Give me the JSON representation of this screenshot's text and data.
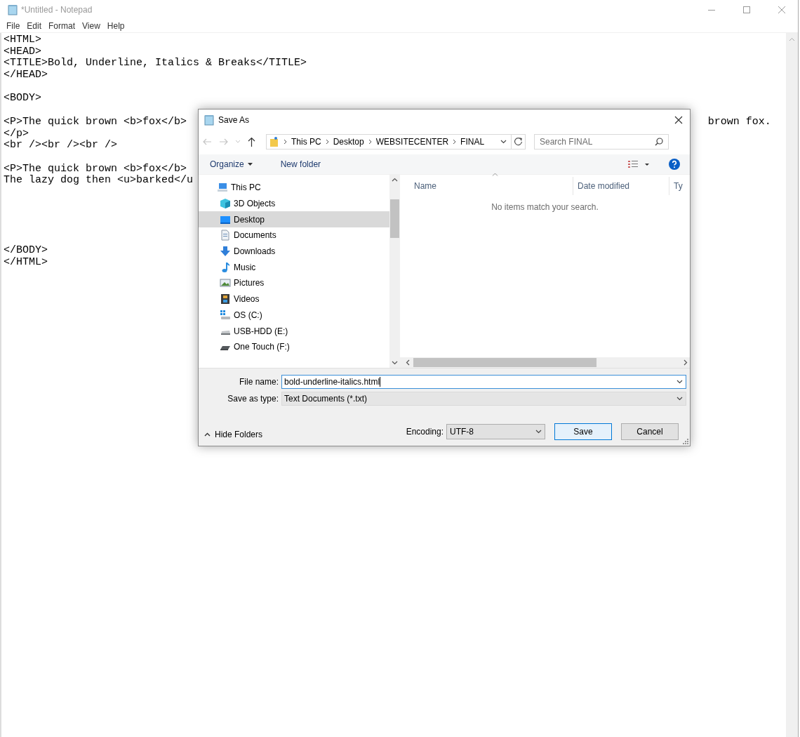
{
  "window": {
    "title": "*Untitled - Notepad"
  },
  "menu": [
    "File",
    "Edit",
    "Format",
    "View",
    "Help"
  ],
  "editor": {
    "lines": [
      {
        "kind": "text",
        "text": "<HTML>"
      },
      {
        "kind": "text",
        "text": "<HEAD>"
      },
      {
        "kind": "text",
        "text": "<TITLE>Bold, Underline, Italics & Breaks</TITLE>"
      },
      {
        "kind": "text",
        "text": "</HEAD>"
      },
      {
        "kind": "blank"
      },
      {
        "kind": "text",
        "text": "<BODY>"
      },
      {
        "kind": "blank"
      },
      {
        "kind": "split",
        "text": "<P>The quick brown <b>fox</b>",
        "text_right": "brown fox."
      },
      {
        "kind": "text",
        "text": "</p>"
      },
      {
        "kind": "text",
        "text": "<br /><br /><br />"
      },
      {
        "kind": "blank"
      },
      {
        "kind": "text",
        "text": "<P>The quick brown <b>fox</b>"
      },
      {
        "kind": "text",
        "text": "The lazy dog then <u>barked</u"
      },
      {
        "kind": "blank"
      },
      {
        "kind": "blank"
      },
      {
        "kind": "blank"
      },
      {
        "kind": "blank"
      },
      {
        "kind": "blank"
      },
      {
        "kind": "text",
        "text": "</BODY>"
      },
      {
        "kind": "text",
        "text": "</HTML>"
      }
    ]
  },
  "dialog": {
    "title": "Save As",
    "breadcrumb": [
      "This PC",
      "Desktop",
      "WEBSITECENTER",
      "FINAL"
    ],
    "search": {
      "placeholder": "Search FINAL"
    },
    "toolbar": {
      "organize": "Organize",
      "new_folder": "New folder"
    },
    "nav_tree": [
      {
        "kind": "pc",
        "label": "This PC",
        "selected": false
      },
      {
        "kind": "objects",
        "label": "3D Objects",
        "selected": false
      },
      {
        "kind": "desktop",
        "label": "Desktop",
        "selected": true
      },
      {
        "kind": "documents",
        "label": "Documents",
        "selected": false
      },
      {
        "kind": "downloads",
        "label": "Downloads",
        "selected": false
      },
      {
        "kind": "music",
        "label": "Music",
        "selected": false
      },
      {
        "kind": "pictures",
        "label": "Pictures",
        "selected": false
      },
      {
        "kind": "videos",
        "label": "Videos",
        "selected": false
      },
      {
        "kind": "os-drive",
        "label": "OS (C:)",
        "selected": false
      },
      {
        "kind": "usb-drive",
        "label": "USB-HDD (E:)",
        "selected": false
      },
      {
        "kind": "external-drive",
        "label": "One Touch (F:)",
        "selected": false
      }
    ],
    "columns": [
      "Name",
      "Date modified",
      "Ty"
    ],
    "empty_message": "No items match your search.",
    "file_name": {
      "label": "File name:",
      "value": "bold-underline-italics.html"
    },
    "save_as_type": {
      "label": "Save as type:",
      "value": "Text Documents (*.txt)"
    },
    "hide_folders": "Hide Folders",
    "encoding": {
      "label": "Encoding:",
      "value": "UTF-8"
    },
    "buttons": [
      {
        "label": "Save",
        "default": true
      },
      {
        "label": "Cancel",
        "default": false
      }
    ]
  }
}
